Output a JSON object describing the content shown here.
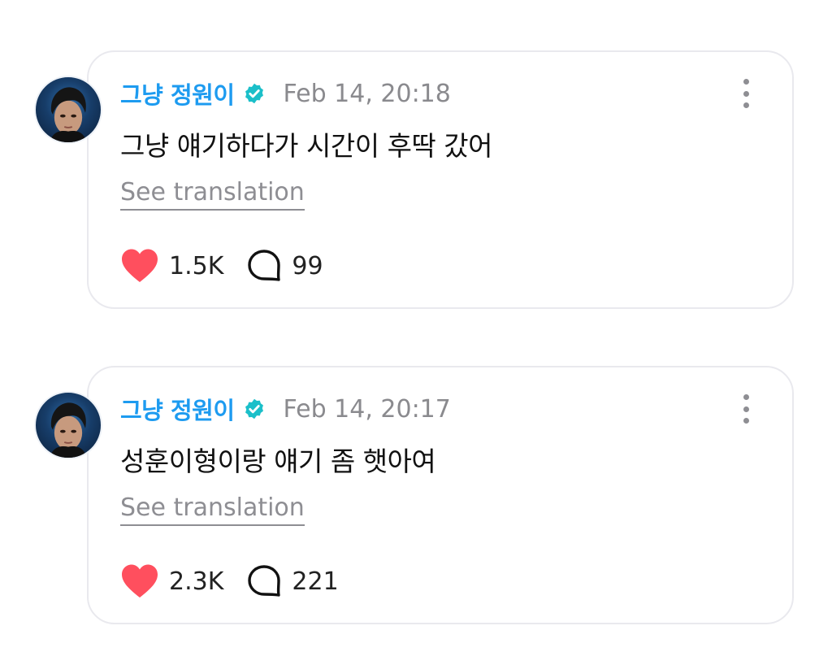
{
  "posts": [
    {
      "username": "그냥 정원이",
      "timestamp": "Feb 14, 20:18",
      "text": "그냥 얘기하다가 시간이 후딱 갔어",
      "translate_label": "See translation",
      "likes": "1.5K",
      "comments": "99"
    },
    {
      "username": "그냥 정원이",
      "timestamp": "Feb 14, 20:17",
      "text": "성훈이형이랑 얘기 좀 햇아여",
      "translate_label": "See translation",
      "likes": "2.3K",
      "comments": "221"
    }
  ],
  "colors": {
    "username": "#1d9bf0",
    "verified": "#1bbfc9",
    "heart": "#ff4f5e",
    "timestamp": "#8a8a8e",
    "card_border": "#e9e9ee"
  },
  "icons": {
    "verified": "verified-badge-icon",
    "more": "more-vertical-icon",
    "like": "heart-icon",
    "comment": "comment-bubble-icon"
  }
}
